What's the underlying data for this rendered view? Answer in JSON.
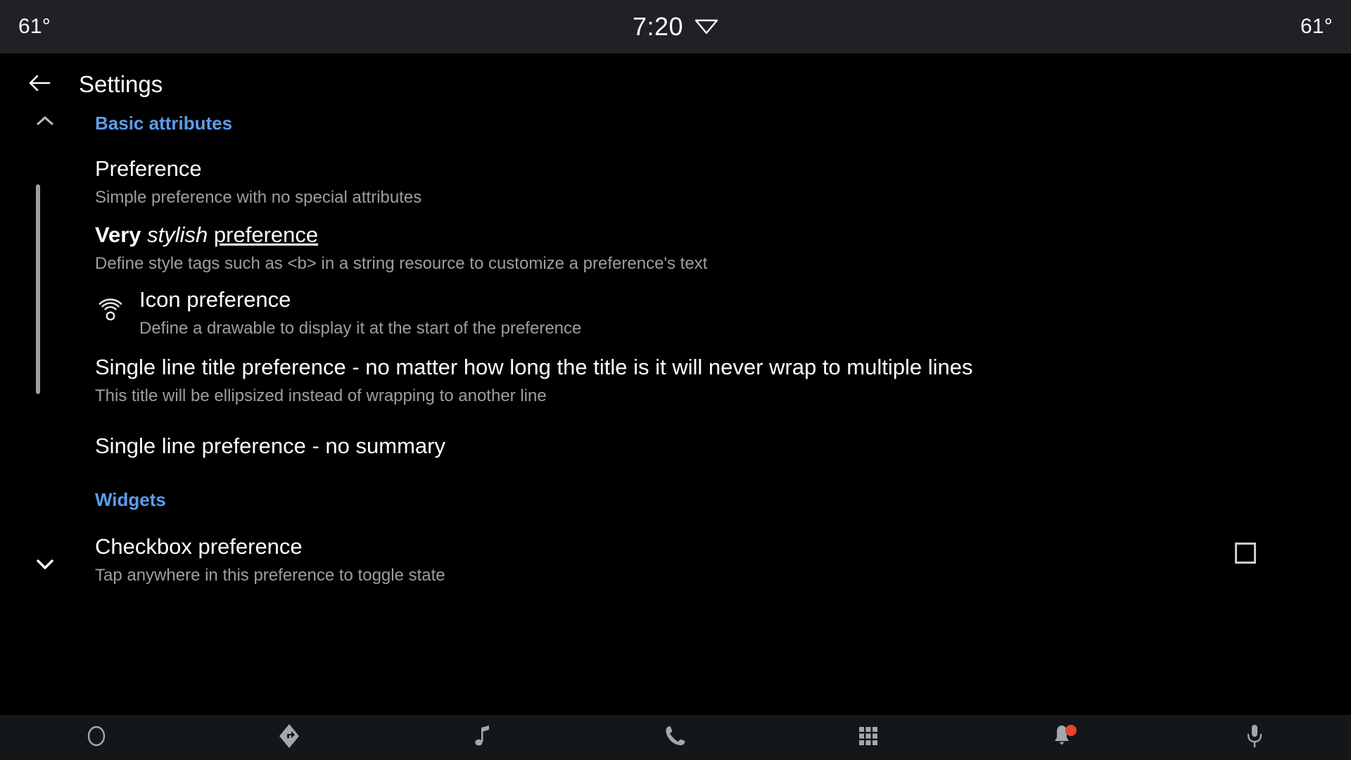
{
  "status_bar": {
    "left_temp": "61°",
    "clock": "7:20",
    "right_temp": "61°",
    "wifi_icon": "wifi-icon"
  },
  "app_bar": {
    "back_icon": "back-arrow-icon",
    "title": "Settings"
  },
  "sections": [
    {
      "header": "Basic attributes",
      "collapse_icon": "chevron-up-icon",
      "items": [
        {
          "title": "Preference",
          "summary": "Simple preference with no special attributes"
        },
        {
          "title_parts": {
            "bold": "Very",
            "italic": "stylish",
            "underline": "preference"
          },
          "title_plain": "Very stylish preference",
          "summary": "Define style tags such as <b> in a string resource to customize a preference's text"
        },
        {
          "icon": "wifi-tethering-icon",
          "title": "Icon preference",
          "summary": "Define a drawable to display it at the start of the preference"
        },
        {
          "title": "Single line title preference - no matter how long the title is it will never wrap to multiple lines",
          "summary": "This title will be ellipsized instead of wrapping to another line"
        },
        {
          "title": "Single line preference - no summary",
          "summary": ""
        }
      ]
    },
    {
      "header": "Widgets",
      "expand_icon": "chevron-down-icon",
      "items": [
        {
          "title": "Checkbox preference",
          "summary": "Tap anywhere in this preference to toggle state",
          "widget": "checkbox",
          "checked": false
        }
      ]
    }
  ],
  "bottom_nav": [
    {
      "icon": "home-circle-icon",
      "label": "Home"
    },
    {
      "icon": "navigation-arrow-icon",
      "label": "Navigation"
    },
    {
      "icon": "music-note-icon",
      "label": "Media"
    },
    {
      "icon": "phone-icon",
      "label": "Phone"
    },
    {
      "icon": "apps-grid-icon",
      "label": "Apps"
    },
    {
      "icon": "bell-icon",
      "label": "Notifications",
      "badge": true
    },
    {
      "icon": "microphone-icon",
      "label": "Assistant"
    }
  ],
  "colors": {
    "accent_blue": "#5c9ded",
    "status_bar_bg": "#202124",
    "nav_bg": "#14171a",
    "badge_red": "#e8442e",
    "summary_gray": "#9e9e9e"
  }
}
